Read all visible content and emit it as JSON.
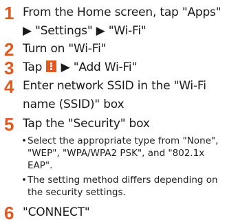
{
  "steps": [
    {
      "number": "1",
      "line1": "From the Home screen, tap \"Apps\"",
      "line2": "▶ \"Settings\" ▶ \"Wi-Fi\""
    },
    {
      "number": "2",
      "line1": "Turn on \"Wi-Fi\""
    },
    {
      "number": "3",
      "prefix": "Tap",
      "suffix": "▶ \"Add Wi-Fi\""
    },
    {
      "number": "4",
      "line1": "Enter network SSID in the \"Wi-Fi",
      "line2": "name (SSID)\" box"
    },
    {
      "number": "5",
      "line1": "Tap the \"Security\" box",
      "notes": [
        {
          "bullet": "•",
          "lines": [
            "Select the appropriate type from \"None\",",
            "\"WEP\", \"WPA/WPA2 PSK\", and \"802.1x",
            "EAP\"."
          ]
        },
        {
          "bullet": "•",
          "lines": [
            "The setting method differs depending on",
            "the security settings."
          ]
        }
      ]
    },
    {
      "number": "6",
      "line1": "\"CONNECT\""
    }
  ],
  "icons": {
    "menu": "more-vertical-icon"
  },
  "colors": {
    "accent": "#e05a20",
    "text": "#1a1a1a"
  }
}
